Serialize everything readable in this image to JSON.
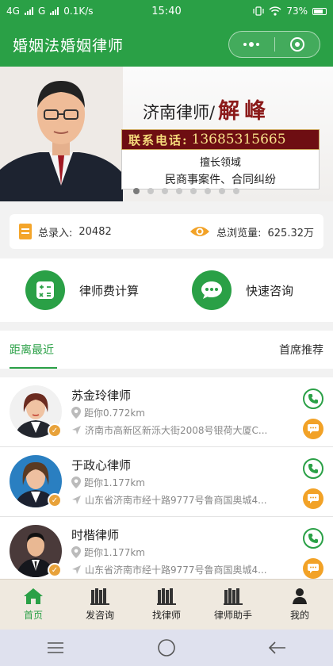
{
  "status_bar": {
    "network": "4G",
    "network2": "G",
    "speed": "0.1K/s",
    "time": "15:40",
    "battery": "73%"
  },
  "header": {
    "title": "婚姻法婚姻律师"
  },
  "banner": {
    "name_prefix": "济南律师/",
    "name": "解峰",
    "phone_label": "联系电话:",
    "phone_number": "13685315665",
    "specialty_title": "擅长领域",
    "specialty": "民商事案件、合同纠纷",
    "slides": 8,
    "active_slide": 1
  },
  "stats": {
    "records_label": "总录入:",
    "records_value": "20482",
    "views_label": "总浏览量:",
    "views_value": "625.32万"
  },
  "actions": [
    {
      "label": "律师费计算",
      "icon": "calculator-icon"
    },
    {
      "label": "快速咨询",
      "icon": "chat-bubble-icon"
    }
  ],
  "tabs": {
    "nearest": "距离最近",
    "recommend": "首席推荐"
  },
  "lawyers": [
    {
      "name": "苏金玲律师",
      "distance": "距你0.772km",
      "address": "济南市高新区新泺大街2008号银荷大厦C..."
    },
    {
      "name": "于政心律师",
      "distance": "距你1.177km",
      "address": "山东省济南市经十路9777号鲁商国奥城4..."
    },
    {
      "name": "时楷律师",
      "distance": "距你1.177km",
      "address": "山东省济南市经十路9777号鲁商国奥城4..."
    }
  ],
  "tabbar": [
    {
      "label": "首页",
      "icon": "home-icon",
      "active": true
    },
    {
      "label": "发咨询",
      "icon": "books-icon"
    },
    {
      "label": "找律师",
      "icon": "books-icon"
    },
    {
      "label": "律师助手",
      "icon": "books-icon"
    },
    {
      "label": "我的",
      "icon": "user-icon"
    }
  ],
  "colors": {
    "primary": "#2aa046",
    "accent": "#f2a227",
    "banner_red": "#6e0e12"
  }
}
